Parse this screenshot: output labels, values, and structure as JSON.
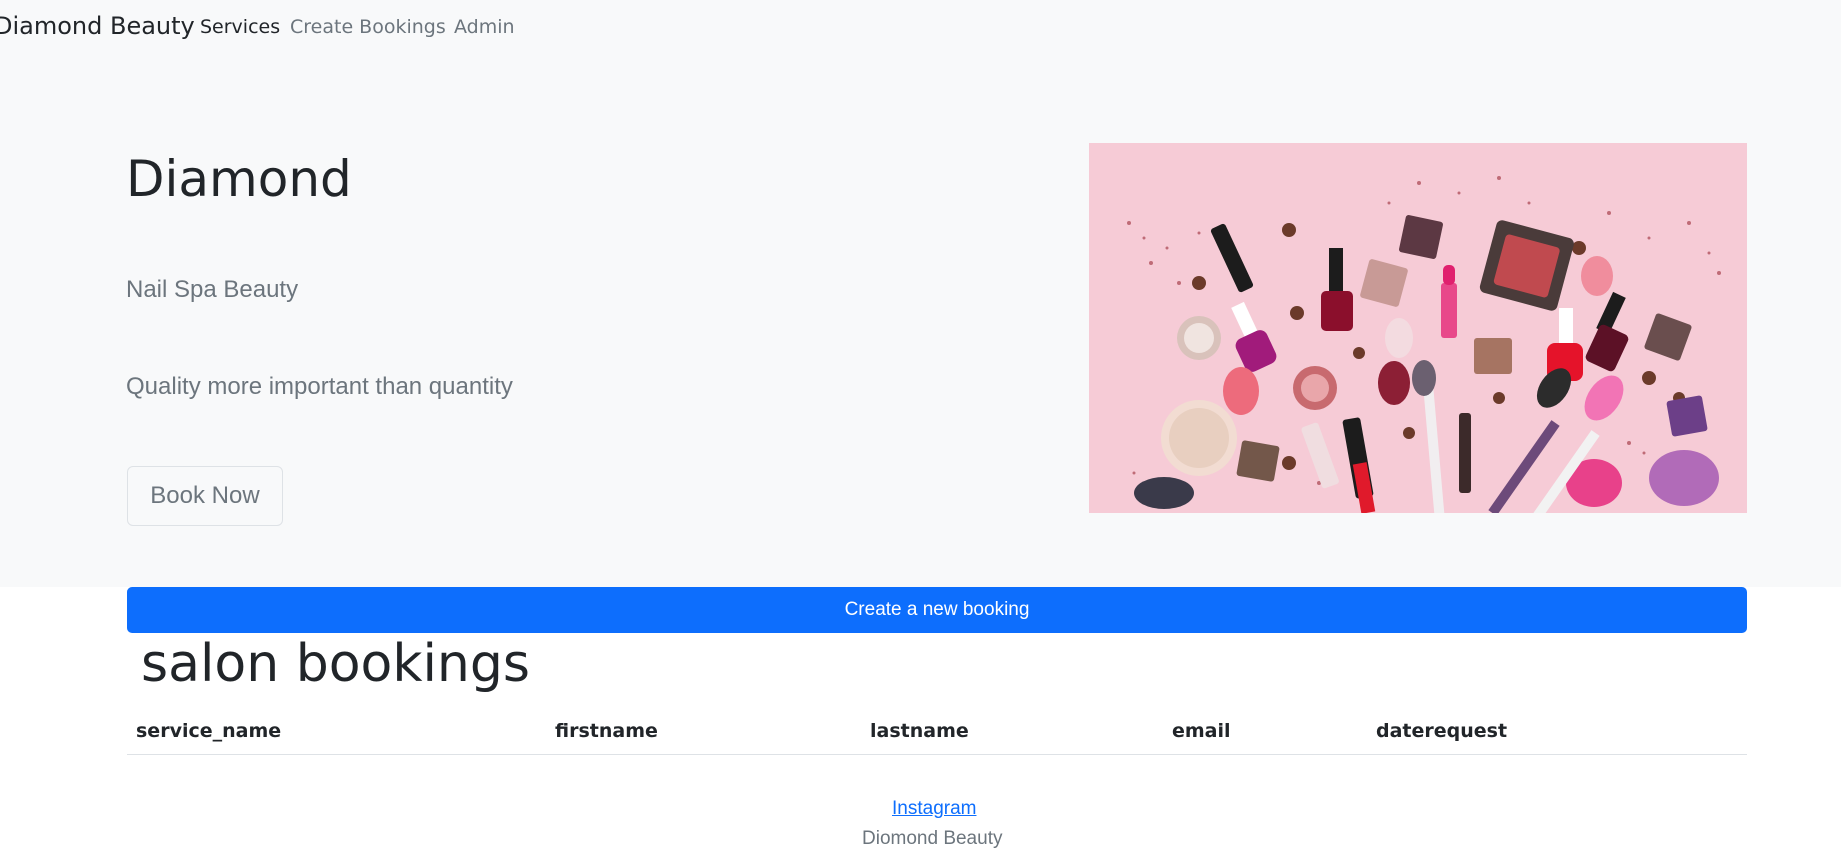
{
  "navbar": {
    "brand": "Diamond Beauty",
    "links": [
      {
        "label": "Services",
        "active": true
      },
      {
        "label": "Create Bookings",
        "active": false
      },
      {
        "label": "Admin",
        "active": false
      }
    ]
  },
  "hero": {
    "title": "Diamond",
    "subtitle1": "Nail Spa Beauty",
    "subtitle2": "Quality more important than quantity",
    "button_label": "Book Now",
    "image_icon": "cosmetics-flatlay-image"
  },
  "bookings": {
    "create_button_label": "Create a new booking",
    "title": "salon bookings",
    "columns": [
      "service_name",
      "firstname",
      "lastname",
      "email",
      "daterequest"
    ],
    "rows": []
  },
  "footer": {
    "link_label": "Instagram",
    "text": "Diomond Beauty"
  },
  "colors": {
    "primary": "#0d6efd",
    "background_light": "#f8f9fa",
    "muted_text": "#6c757d",
    "image_bg": "#f5c9d4"
  }
}
